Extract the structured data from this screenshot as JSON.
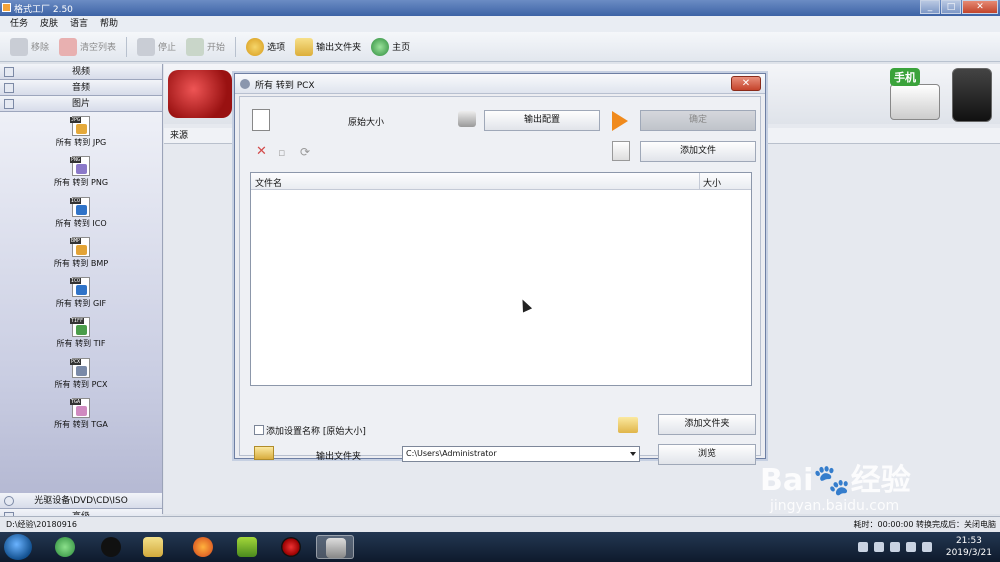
{
  "window": {
    "title": "格式工厂 2.50",
    "controls": [
      "_",
      "□",
      "✕"
    ]
  },
  "menu": [
    "任务",
    "皮肤",
    "语言",
    "帮助"
  ],
  "toolbar": {
    "remove": "移除",
    "clear_list": "清空列表",
    "stop": "停止",
    "start": "开始",
    "options": "选项",
    "output_folder": "输出文件夹",
    "home": "主页"
  },
  "sidebar": {
    "video": "视频",
    "audio": "音频",
    "picture": "图片",
    "formats": [
      {
        "tag": "JPG",
        "label": "所有 转到 JPG",
        "color": "#e5a93a"
      },
      {
        "tag": "PNG",
        "label": "所有 转到 PNG",
        "color": "#8b79c9"
      },
      {
        "tag": "ICO",
        "label": "所有 转到 ICO",
        "color": "#2f73c8"
      },
      {
        "tag": "BMP",
        "label": "所有 转到 BMP",
        "color": "#e3a335"
      },
      {
        "tag": "ICO",
        "label": "所有 转到 GIF",
        "color": "#2f73c8"
      },
      {
        "tag": "TIFF",
        "label": "所有 转到 TIF",
        "color": "#4a9d4a"
      },
      {
        "tag": "PCX",
        "label": "所有 转到 PCX",
        "color": "#7a8aa8"
      },
      {
        "tag": "TGA",
        "label": "所有 转到 TGA",
        "color": "#d08ac0"
      }
    ],
    "optical": "光驱设备\\DVD\\CD\\ISO",
    "advanced": "高级"
  },
  "main": {
    "source_header": "来源",
    "phone_label": "手机"
  },
  "dialog": {
    "title": "所有 转到 PCX",
    "original_size": "原始大小",
    "output_config": "输出配置",
    "ok": "确定",
    "add_file": "添加文件",
    "col_filename": "文件名",
    "col_size": "大小",
    "add_setting_name": "添加设置名称 [原始大小]",
    "add_folder": "添加文件夹",
    "output_folder_label": "输出文件夹",
    "output_path": "C:\\Users\\Administrator",
    "browse": "浏览",
    "close": "✕"
  },
  "status": {
    "left": "D:\\经验\\20180916",
    "right": "耗时：00:00:00 转换完成后：关闭电脑"
  },
  "taskbar": {
    "time": "21:53",
    "date": "2019/3/21"
  },
  "watermark": {
    "main": "Bai🐾经验",
    "sub": "jingyan.baidu.com"
  }
}
